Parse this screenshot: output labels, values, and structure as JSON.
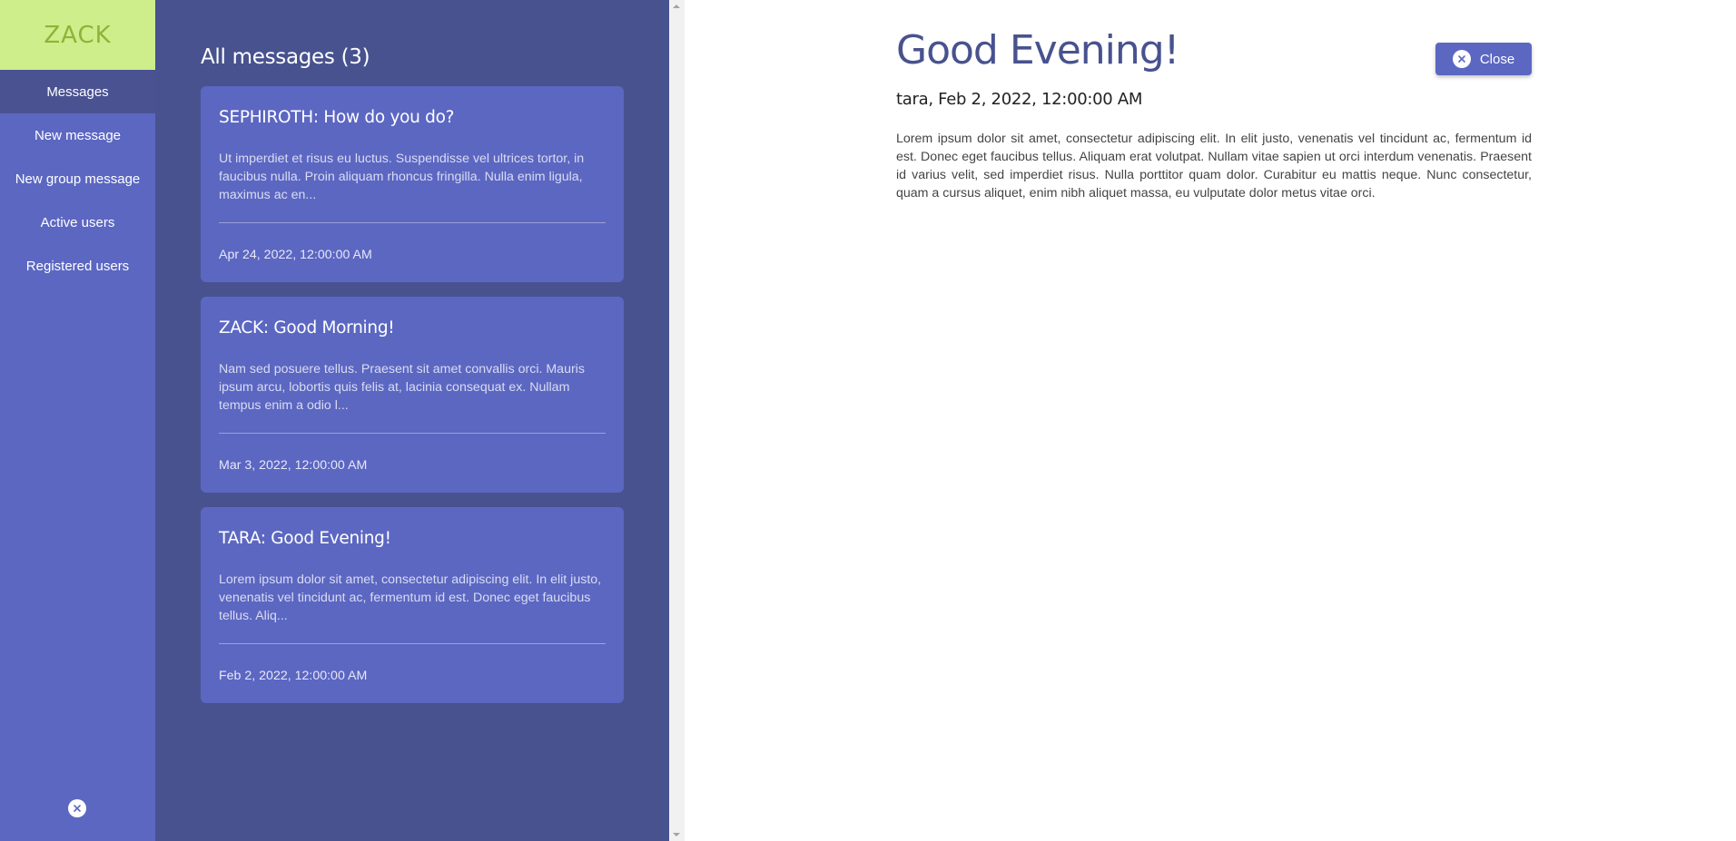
{
  "sidebar": {
    "logo": "ZACK",
    "items": [
      {
        "label": "Messages"
      },
      {
        "label": "New message"
      },
      {
        "label": "New group message"
      },
      {
        "label": "Active users"
      },
      {
        "label": "Registered users"
      }
    ],
    "close_icon": "close-circle-icon"
  },
  "list": {
    "title": "All messages (3)",
    "messages": [
      {
        "title": "SEPHIROTH: How do you do?",
        "preview": "Ut imperdiet et risus eu luctus. Suspendisse vel ultrices tortor, in faucibus nulla. Proin aliquam rhoncus fringilla. Nulla enim ligula, maximus ac en...",
        "date": "Apr 24, 2022, 12:00:00 AM"
      },
      {
        "title": "ZACK: Good Morning!",
        "preview": "Nam sed posuere tellus. Praesent sit amet convallis orci. Mauris ipsum arcu, lobortis quis felis at, lacinia consequat ex. Nullam tempus enim a odio l...",
        "date": "Mar 3, 2022, 12:00:00 AM"
      },
      {
        "title": "TARA: Good Evening!",
        "preview": "Lorem ipsum dolor sit amet, consectetur adipiscing elit. In elit justo, venenatis vel tincidunt ac, fermentum id est. Donec eget faucibus tellus. Aliq...",
        "date": "Feb 2, 2022, 12:00:00 AM"
      }
    ]
  },
  "detail": {
    "title": "Good Evening!",
    "meta": "tara, Feb 2, 2022, 12:00:00 AM",
    "body": "Lorem ipsum dolor sit amet, consectetur adipiscing elit. In elit justo, venenatis vel tincidunt ac, fermentum id est. Donec eget faucibus tellus. Aliquam erat volutpat. Nullam vitae sapien ut orci interdum venenatis. Praesent id varius velit, sed imperdiet risus. Nulla porttitor quam dolor. Curabitur eu mattis neque. Nunc consectetur, quam a cursus aliquet, enim nibh aliquet massa, eu vulputate dolor metus vitae orci.",
    "close_label": "Close"
  },
  "colors": {
    "sidebar": "#5c67c2",
    "panel": "#48528f",
    "logo_bg": "#cdee8a",
    "logo_text": "#8fb23a",
    "title": "#48528f"
  }
}
